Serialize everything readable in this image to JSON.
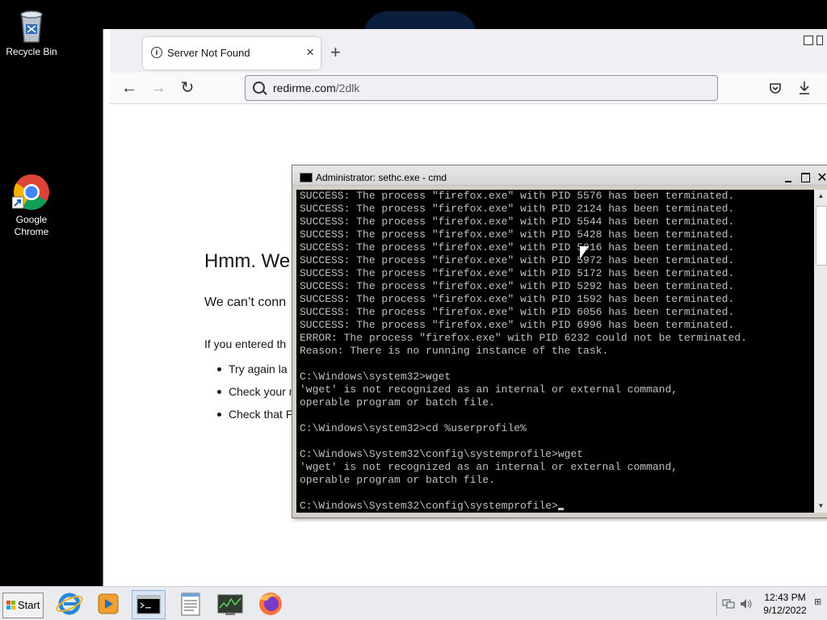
{
  "desktop": {
    "icons": [
      {
        "label": "Recycle Bin",
        "icon": "recycle-bin-icon"
      },
      {
        "label": "Google Chrome",
        "icon": "chrome-icon"
      }
    ]
  },
  "browser": {
    "tab": {
      "title": "Server Not Found",
      "icon": "info-icon"
    },
    "url": {
      "host": "redirme.com",
      "path": "/2dlk"
    },
    "error": {
      "title": "Hmm. We",
      "subtitle": "We can’t conn",
      "body": "If you entered th",
      "suggestions": [
        "Try again la",
        "Check your n",
        "Check that F"
      ]
    }
  },
  "cmd": {
    "title": "Administrator: sethc.exe - cmd",
    "lines": [
      "SUCCESS: The process \"firefox.exe\" with PID 5576 has been terminated.",
      "SUCCESS: The process \"firefox.exe\" with PID 2124 has been terminated.",
      "SUCCESS: The process \"firefox.exe\" with PID 5544 has been terminated.",
      "SUCCESS: The process \"firefox.exe\" with PID 5428 has been terminated.",
      "SUCCESS: The process \"firefox.exe\" with PID 5016 has been terminated.",
      "SUCCESS: The process \"firefox.exe\" with PID 5972 has been terminated.",
      "SUCCESS: The process \"firefox.exe\" with PID 5172 has been terminated.",
      "SUCCESS: The process \"firefox.exe\" with PID 5292 has been terminated.",
      "SUCCESS: The process \"firefox.exe\" with PID 1592 has been terminated.",
      "SUCCESS: The process \"firefox.exe\" with PID 6056 has been terminated.",
      "SUCCESS: The process \"firefox.exe\" with PID 6996 has been terminated.",
      "ERROR: The process \"firefox.exe\" with PID 6232 could not be terminated.",
      "Reason: There is no running instance of the task.",
      "",
      "C:\\Windows\\system32>wget",
      "'wget' is not recognized as an internal or external command,",
      "operable program or batch file.",
      "",
      "C:\\Windows\\system32>cd %userprofile%",
      "",
      "C:\\Windows\\System32\\config\\systemprofile>wget",
      "'wget' is not recognized as an internal or external command,",
      "operable program or batch file.",
      ""
    ],
    "prompt": "C:\\Windows\\System32\\config\\systemprofile>"
  },
  "taskbar": {
    "start_label": "Start",
    "apps": [
      "internet-explorer-icon",
      "media-player-icon",
      "cmd-icon",
      "notepad-icon",
      "task-manager-icon",
      "firefox-icon"
    ],
    "clock": {
      "time": "12:43 PM",
      "date": "9/12/2022"
    }
  },
  "colors": {
    "console_bg": "#000000",
    "console_text": "#c0c0c0",
    "desktop_bg": "#000000",
    "taskbar_bg": "#e9ebee"
  }
}
